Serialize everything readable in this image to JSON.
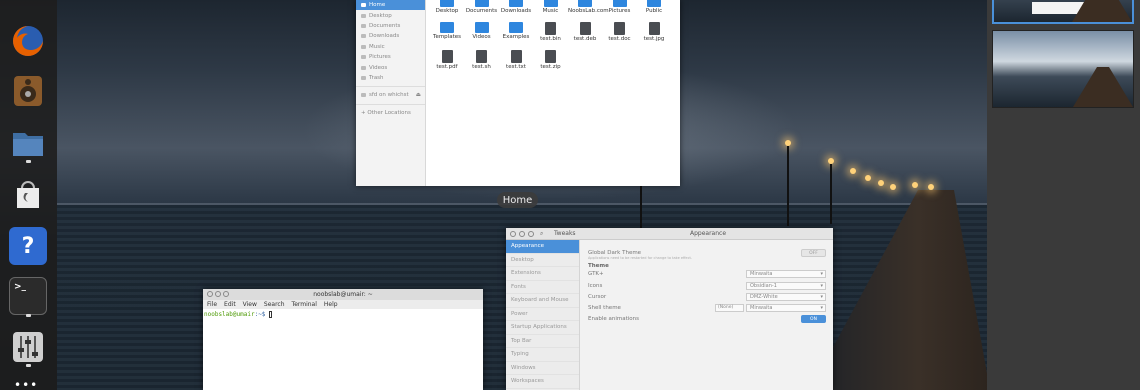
{
  "dock": {
    "items": [
      {
        "name": "firefox-icon",
        "color": "#e66000"
      },
      {
        "name": "speaker-icon",
        "color": "#8a5a2b"
      },
      {
        "name": "files-icon",
        "color": "#3f6fa3"
      },
      {
        "name": "software-icon",
        "color": "#e8e8e8"
      },
      {
        "name": "help-icon",
        "color": "#2f6ad0",
        "glyph": "?"
      },
      {
        "name": "terminal-icon",
        "color": "#2b2b2b",
        "glyph": ">_"
      },
      {
        "name": "tweaks-icon",
        "color": "#cfcfcf"
      }
    ],
    "more_glyph": "•••"
  },
  "files": {
    "sidebar": [
      "Home",
      "Desktop",
      "Documents",
      "Downloads",
      "Music",
      "Pictures",
      "Videos",
      "Trash"
    ],
    "network_item": "sfd on whichst",
    "other_locations": "+ Other Locations",
    "items": [
      {
        "label": "Desktop",
        "kind": "folder"
      },
      {
        "label": "Documents",
        "kind": "folder"
      },
      {
        "label": "Downloads",
        "kind": "folder"
      },
      {
        "label": "Music",
        "kind": "folder"
      },
      {
        "label": "NoobsLab.com",
        "kind": "folder"
      },
      {
        "label": "Pictures",
        "kind": "folder"
      },
      {
        "label": "Public",
        "kind": "folder"
      },
      {
        "label": "Templates",
        "kind": "folder"
      },
      {
        "label": "Videos",
        "kind": "folder"
      },
      {
        "label": "Examples",
        "kind": "folder"
      },
      {
        "label": "test.bin",
        "kind": "doc"
      },
      {
        "label": "test.deb",
        "kind": "doc"
      },
      {
        "label": "test.doc",
        "kind": "doc"
      },
      {
        "label": "test.jpg",
        "kind": "doc"
      },
      {
        "label": "test.pdf",
        "kind": "doc"
      },
      {
        "label": "test.sh",
        "kind": "doc"
      },
      {
        "label": "test.txt",
        "kind": "doc"
      },
      {
        "label": "test.zip",
        "kind": "doc"
      }
    ]
  },
  "overview_label": "Home",
  "tweaks": {
    "app_title": "Tweaks",
    "pane_title": "Appearance",
    "sidebar": [
      "Appearance",
      "Desktop",
      "Extensions",
      "Fonts",
      "Keyboard and Mouse",
      "Power",
      "Startup Applications",
      "Top Bar",
      "Typing",
      "Windows",
      "Workspaces"
    ],
    "global_dark": "Global Dark Theme",
    "global_dark_note": "Applications need to be restarted for change to take effect.",
    "global_dark_toggle": "OFF",
    "theme_heading": "Theme",
    "gtk_label": "GTK+",
    "gtk_value": "Minwaita",
    "icons_label": "Icons",
    "icons_value": "Obsidian-1",
    "cursor_label": "Cursor",
    "cursor_value": "DMZ-White",
    "shell_label": "Shell theme",
    "shell_none": "(None)",
    "shell_value": "Minwaita",
    "anim_label": "Enable animations",
    "anim_toggle": "ON"
  },
  "terminal": {
    "title": "noobslab@umair: ~",
    "menu": [
      "File",
      "Edit",
      "View",
      "Search",
      "Terminal",
      "Help"
    ],
    "prompt_user": "noobslab@umair",
    "prompt_path": ":~$"
  },
  "colors": {
    "accent": "#4a90d9"
  }
}
